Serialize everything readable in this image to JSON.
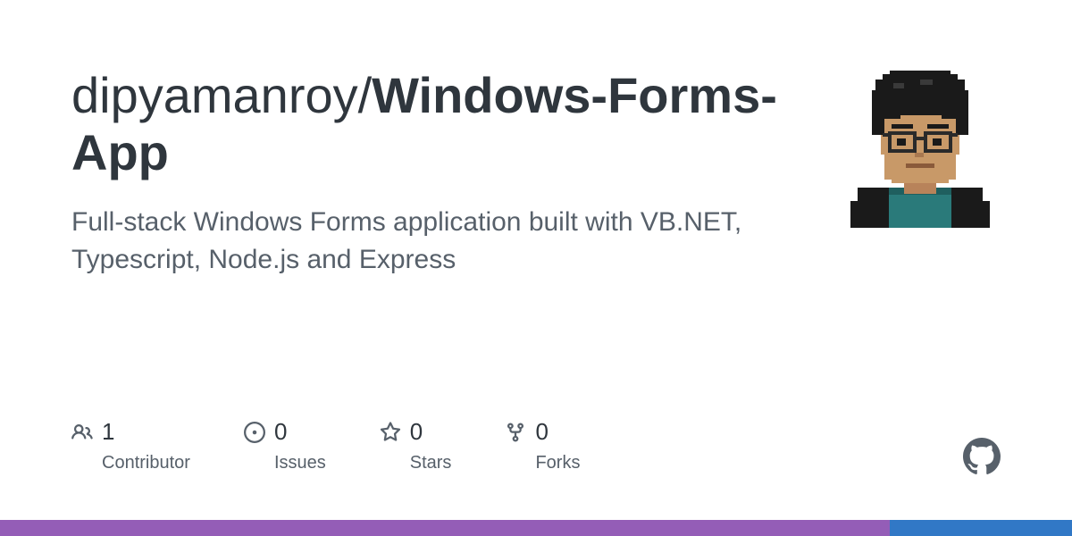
{
  "repo": {
    "owner": "dipyamanroy",
    "name": "Windows-Forms-App",
    "description": "Full-stack Windows Forms application built with VB.NET, Typescript, Node.js and Express"
  },
  "stats": {
    "contributors": {
      "count": "1",
      "label": "Contributor"
    },
    "issues": {
      "count": "0",
      "label": "Issues"
    },
    "stars": {
      "count": "0",
      "label": "Stars"
    },
    "forks": {
      "count": "0",
      "label": "Forks"
    }
  },
  "language_bar": [
    {
      "color": "#945db7",
      "width": "83%"
    },
    {
      "color": "#3178c6",
      "width": "17%"
    }
  ]
}
